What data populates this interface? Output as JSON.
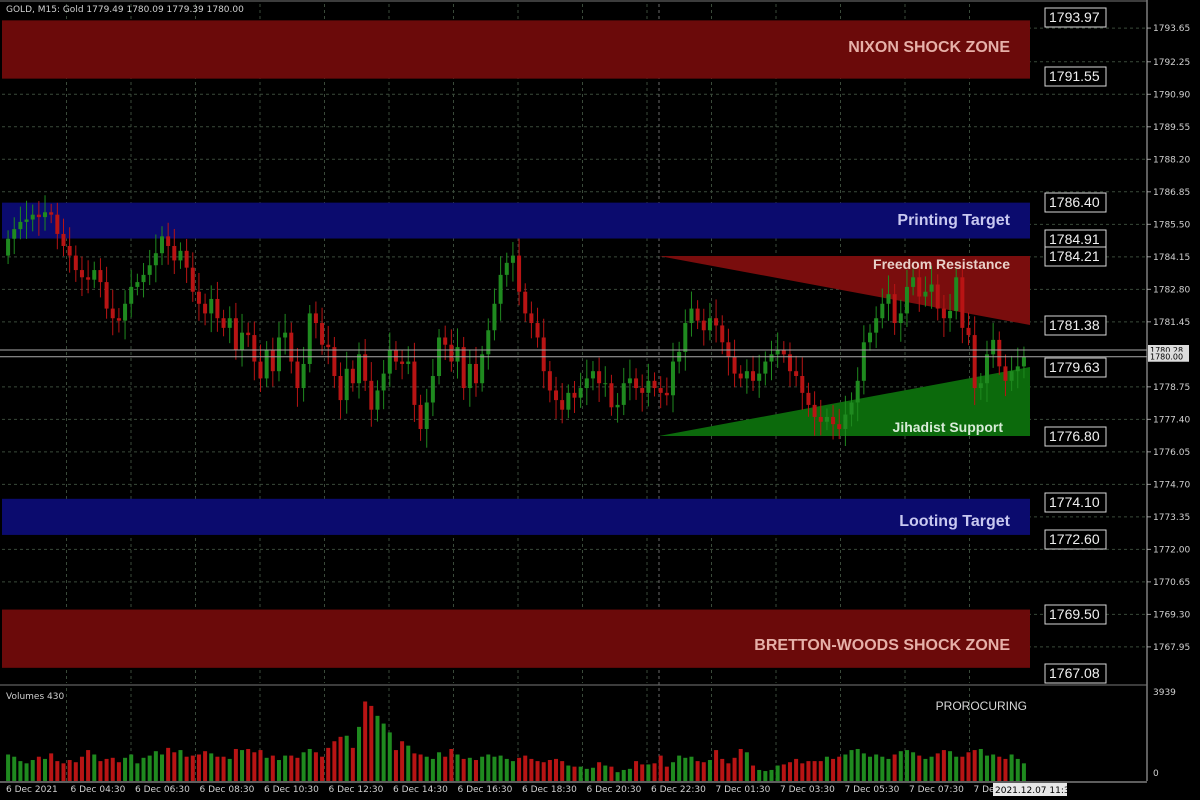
{
  "header": {
    "symbol_info": "GOLD, M15:  Gold  1779.49  1780.09  1779.39  1780.00",
    "volume_label": "Volumes 430",
    "indicator_label": "PROROCURING"
  },
  "colors": {
    "background": "#000000",
    "grid": "#3a4a3a",
    "bull": "#1f8a1f",
    "bear": "#b81414",
    "zone_red": "#6b0a0a",
    "zone_blue": "#0b0b6e",
    "triangle_red": "#7a0d0d",
    "triangle_green": "#0c6a0c"
  },
  "chart_data": {
    "type": "candlestick",
    "symbol": "GOLD",
    "timeframe": "M15",
    "ylim": [
      1767.08,
      1793.97
    ],
    "price_ticks": [
      "1793.65",
      "1792.25",
      "1790.90",
      "1789.55",
      "1788.20",
      "1786.85",
      "1785.50",
      "1784.15",
      "1782.80",
      "1781.45",
      "1778.75",
      "1777.40",
      "1776.05",
      "1774.70",
      "1773.35",
      "1772.00",
      "1770.65",
      "1769.30",
      "1767.95"
    ],
    "current_price_labels": [
      "1780.28",
      "1780.00"
    ],
    "time_labels": [
      "6 Dec 2021",
      "6 Dec 04:30",
      "6 Dec 06:30",
      "6 Dec 08:30",
      "6 Dec 10:30",
      "6 Dec 12:30",
      "6 Dec 14:30",
      "6 Dec 16:30",
      "6 Dec 18:30",
      "6 Dec 20:30",
      "6 Dec 22:30",
      "7 Dec 01:30",
      "7 Dec 03:30",
      "7 Dec 05:30",
      "7 Dec 07:30",
      "7 Dec 0",
      "2021.12.07 11:39"
    ],
    "zones": [
      {
        "label": "NIXON SHOCK ZONE",
        "top": 1793.97,
        "bottom": 1791.55,
        "kind": "red"
      },
      {
        "label": "Printing Target",
        "top": 1786.4,
        "bottom": 1784.91,
        "kind": "blue"
      },
      {
        "label": "Looting Target",
        "top": 1774.1,
        "bottom": 1772.6,
        "kind": "blue"
      },
      {
        "label": "BRETTON-WOODS SHOCK ZONE",
        "top": 1769.5,
        "bottom": 1767.08,
        "kind": "red"
      }
    ],
    "triangles": [
      {
        "label": "Freedom Resistance",
        "kind": "red"
      },
      {
        "label": "Jihadist Support",
        "kind": "green"
      }
    ],
    "level_labels": [
      "1793.97",
      "1791.55",
      "1786.40",
      "1784.91",
      "1784.21",
      "1781.38",
      "1779.63",
      "1776.80",
      "1774.10",
      "1772.60",
      "1769.50",
      "1767.08"
    ],
    "volume_ticks": [
      "3939",
      "0"
    ],
    "closes": [
      1784.9,
      1785.3,
      1785.6,
      1785.7,
      1785.9,
      1785.8,
      1786.0,
      1785.9,
      1785.1,
      1784.6,
      1784.2,
      1783.6,
      1783.3,
      1783.2,
      1783.6,
      1783.1,
      1782.0,
      1781.6,
      1781.5,
      1782.2,
      1782.9,
      1783.1,
      1783.4,
      1783.8,
      1784.3,
      1785.0,
      1784.6,
      1784.0,
      1784.4,
      1783.7,
      1782.7,
      1782.2,
      1781.8,
      1782.4,
      1781.6,
      1781.2,
      1781.6,
      1780.3,
      1781.0,
      1780.9,
      1779.8,
      1779.1,
      1780.3,
      1779.4,
      1780.8,
      1781.0,
      1779.8,
      1778.7,
      1779.7,
      1781.8,
      1781.4,
      1780.5,
      1780.4,
      1779.2,
      1778.2,
      1779.5,
      1778.9,
      1780.1,
      1779.0,
      1777.8,
      1778.6,
      1779.3,
      1780.3,
      1779.8,
      1779.7,
      1779.8,
      1778.0,
      1777.0,
      1778.1,
      1779.2,
      1780.8,
      1780.5,
      1779.8,
      1780.4,
      1778.7,
      1779.7,
      1778.9,
      1780.1,
      1781.1,
      1782.2,
      1783.4,
      1783.9,
      1784.2,
      1782.7,
      1781.8,
      1781.4,
      1780.8,
      1779.4,
      1778.6,
      1778.2,
      1777.8,
      1778.5,
      1778.3,
      1778.7,
      1779.1,
      1779.4,
      1778.9,
      1778.9,
      1777.9,
      1778.0,
      1778.9,
      1779.1,
      1778.7,
      1778.5,
      1779.0,
      1778.7,
      1778.5,
      1778.4,
      1779.8,
      1780.2,
      1781.4,
      1782.0,
      1781.5,
      1781.1,
      1781.6,
      1781.3,
      1780.6,
      1780.0,
      1779.3,
      1779.1,
      1779.4,
      1779.0,
      1779.3,
      1779.8,
      1780.1,
      1780.3,
      1780.1,
      1779.4,
      1779.2,
      1778.5,
      1778.0,
      1777.5,
      1777.3,
      1777.5,
      1777.2,
      1777.0,
      1777.6,
      1778.1,
      1779.0,
      1780.6,
      1781.0,
      1781.6,
      1782.2,
      1782.6,
      1781.4,
      1781.8,
      1782.9,
      1783.3,
      1782.5,
      1782.7,
      1783.0,
      1782.0,
      1781.6,
      1781.9,
      1783.3,
      1781.2,
      1780.9,
      1778.7,
      1778.9,
      1780.1,
      1780.7,
      1779.6,
      1779.0,
      1779.4,
      1779.6,
      1780.0
    ],
    "volumes": [
      1200,
      1100,
      900,
      800,
      950,
      1100,
      1000,
      1250,
      900,
      800,
      950,
      850,
      1100,
      1400,
      1200,
      900,
      1000,
      1050,
      850,
      1050,
      1200,
      800,
      1050,
      1150,
      1350,
      1200,
      1500,
      1300,
      1400,
      1100,
      1150,
      1200,
      1350,
      1250,
      1100,
      1100,
      1000,
      1450,
      1400,
      1450,
      1300,
      1400,
      1050,
      1150,
      950,
      1150,
      1150,
      1050,
      1300,
      1450,
      1300,
      1100,
      1500,
      1800,
      2000,
      2050,
      1500,
      2450,
      3600,
      3400,
      2950,
      2600,
      2200,
      1400,
      1800,
      1600,
      1250,
      1200,
      1100,
      1000,
      1300,
      1100,
      1450,
      1200,
      1000,
      1050,
      950,
      1100,
      1200,
      1100,
      1150,
      1000,
      900,
      1050,
      1150,
      1000,
      900,
      850,
      950,
      1000,
      900,
      700,
      650,
      650,
      550,
      600,
      850,
      700,
      650,
      400,
      500,
      550,
      900,
      750,
      750,
      800,
      1150,
      650,
      850,
      1150,
      1050,
      1100,
      900,
      850,
      950,
      1400,
      1000,
      800,
      1050,
      1450,
      1300,
      700,
      500,
      450,
      500,
      700,
      750,
      850,
      1000,
      800,
      900,
      900,
      900,
      1100,
      1000,
      1100,
      1200,
      1400,
      1450,
      1250,
      1100,
      1200,
      1100,
      1000,
      1200,
      1350,
      1400,
      1300,
      1150,
      1000,
      1100,
      1250,
      1400,
      1350,
      1100,
      1100,
      1300,
      1400,
      1450,
      1150,
      1200,
      1100,
      1000,
      1200,
      1000,
      800
    ]
  }
}
